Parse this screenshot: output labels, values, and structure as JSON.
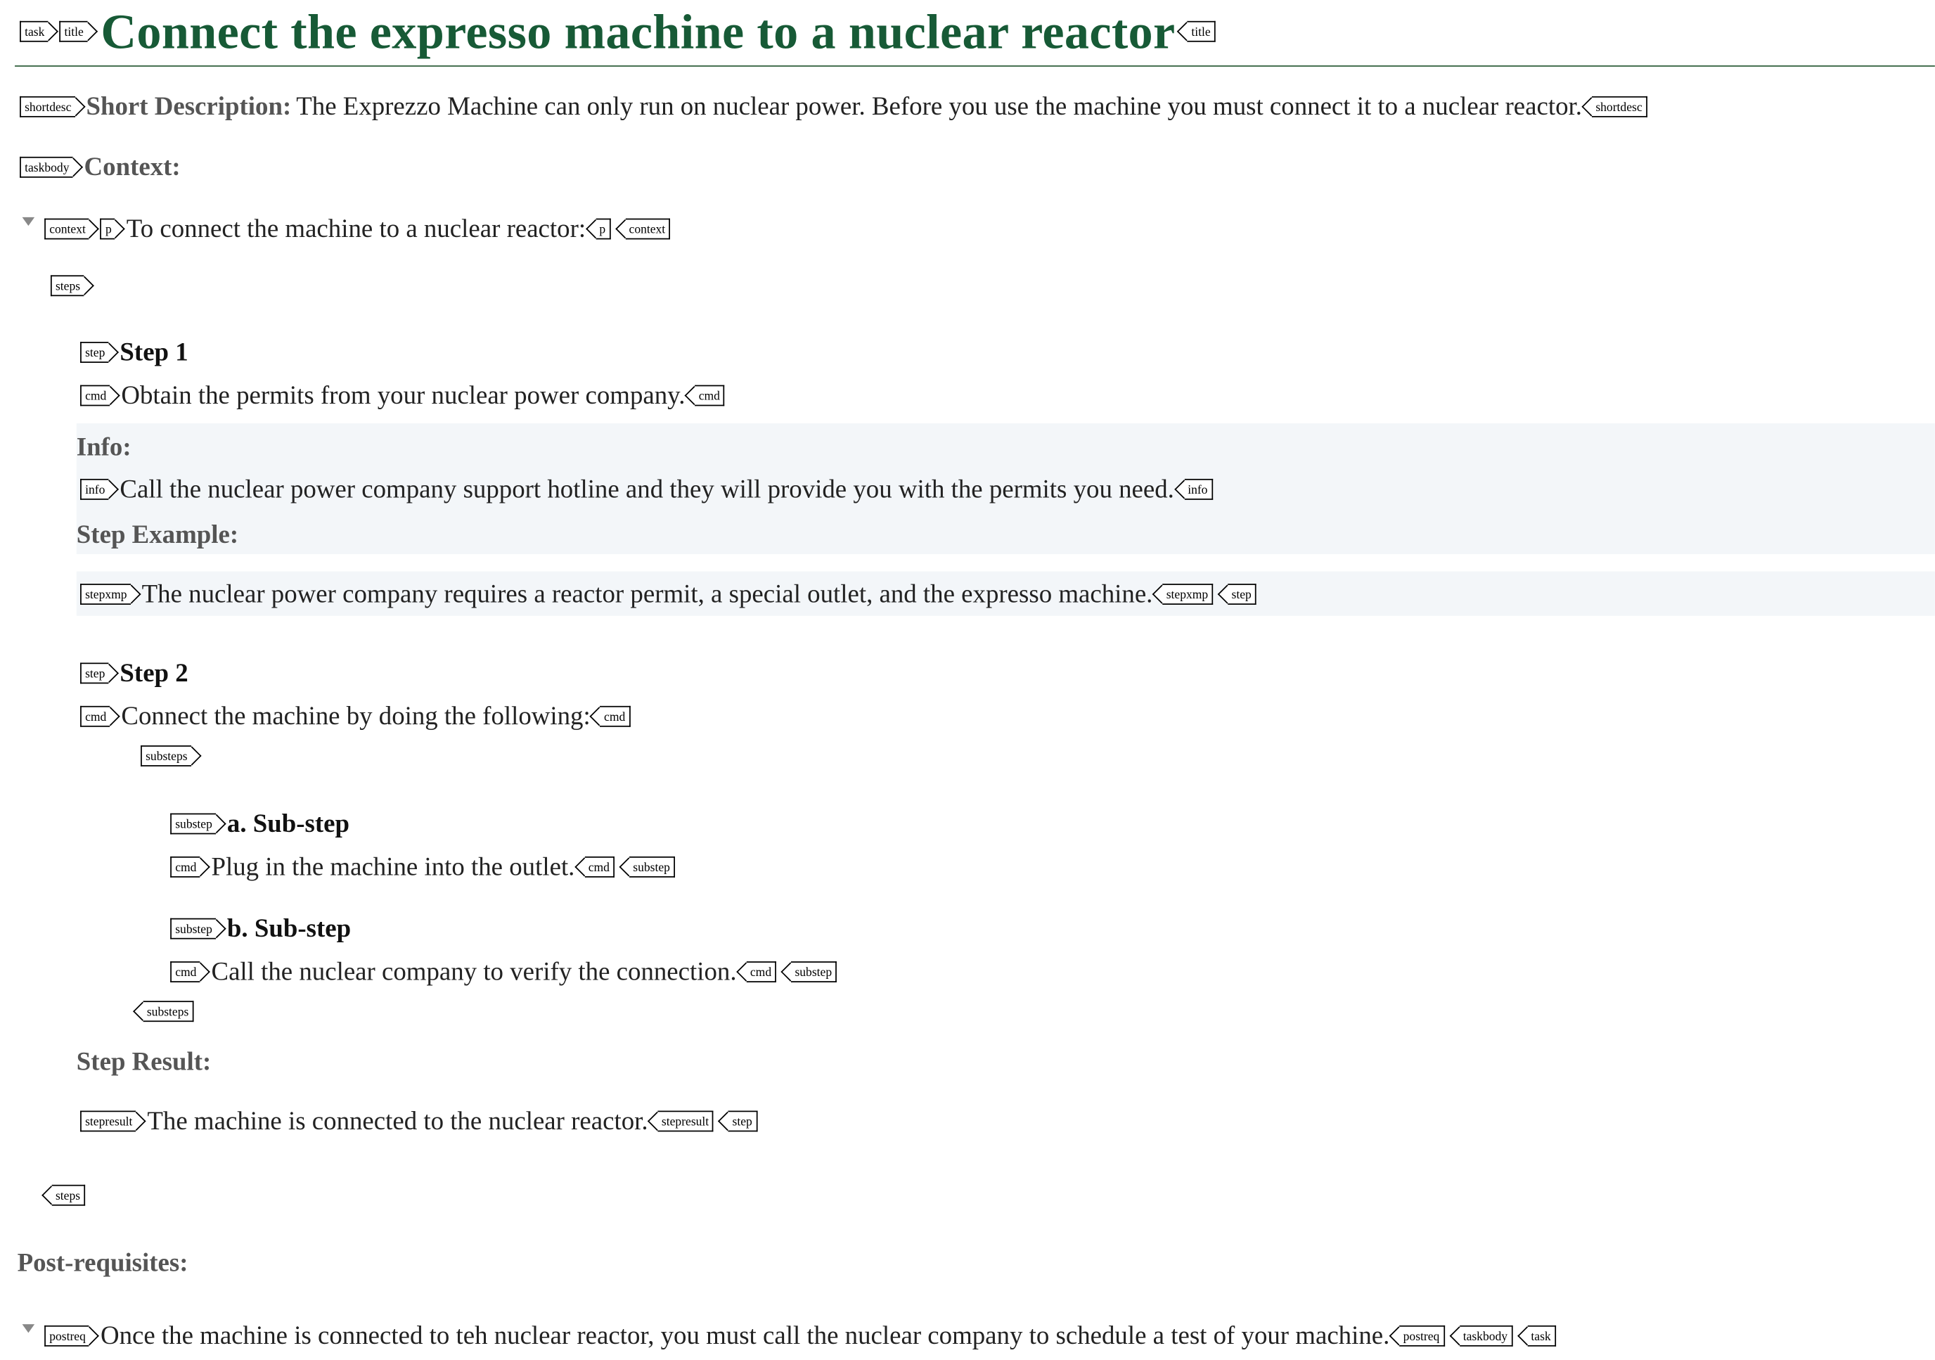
{
  "tags": {
    "task": "task",
    "title": "title",
    "shortdesc": "shortdesc",
    "taskbody": "taskbody",
    "context": "context",
    "p": "p",
    "steps": "steps",
    "step": "step",
    "cmd": "cmd",
    "info": "info",
    "stepxmp": "stepxmp",
    "substeps": "substeps",
    "substep": "substep",
    "stepresult": "stepresult",
    "postreq": "postreq"
  },
  "doc": {
    "title": "Connect the expresso machine to a nuclear reactor",
    "shortdesc_label": "Short Description:",
    "shortdesc": "The Exprezzo Machine can only run on nuclear power. Before you use the machine you must connect it to a nuclear reactor.",
    "context_label": "Context:",
    "context_text": "To connect the machine to a nuclear reactor:",
    "step1_title": "Step 1",
    "step1_cmd": "Obtain the permits from your nuclear power company.",
    "info_label": "Info:",
    "step1_info": "Call the nuclear power company support hotline and they will provide you with the permits you need.",
    "stepxmp_label": "Step Example:",
    "step1_xmp": "The nuclear power company requires a reactor permit, a special outlet, and the expresso machine.",
    "step2_title": "Step 2",
    "step2_cmd": "Connect the machine by doing the following:",
    "substep_a_title": "a. Sub-step",
    "substep_a_cmd": "Plug in the machine into the outlet.",
    "substep_b_title": "b. Sub-step",
    "substep_b_cmd": "Call the nuclear company to verify the connection.",
    "stepresult_label": "Step Result:",
    "step2_result": "The machine is connected to the nuclear reactor.",
    "postreq_label": "Post-requisites:",
    "postreq_text": "Once the machine is connected to teh nuclear reactor, you must call the nuclear company to schedule a test of your machine."
  },
  "icons": {
    "collapse": "collapse-triangle-icon"
  }
}
